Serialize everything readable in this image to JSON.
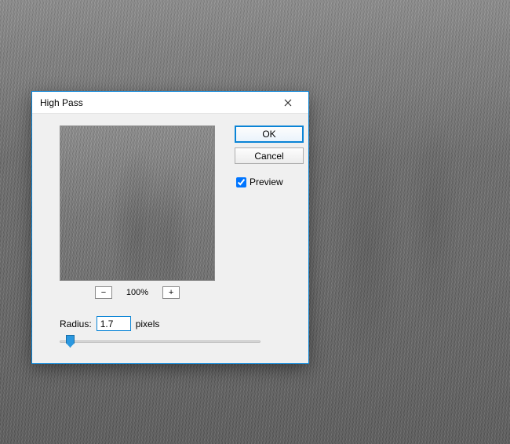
{
  "dialog": {
    "title": "High Pass",
    "ok_label": "OK",
    "cancel_label": "Cancel",
    "preview_label": "Preview",
    "preview_checked": true,
    "zoom": {
      "minus_label": "−",
      "value": "100%",
      "plus_label": "+"
    },
    "radius": {
      "label": "Radius:",
      "value": "1.7",
      "unit": "pixels"
    }
  }
}
